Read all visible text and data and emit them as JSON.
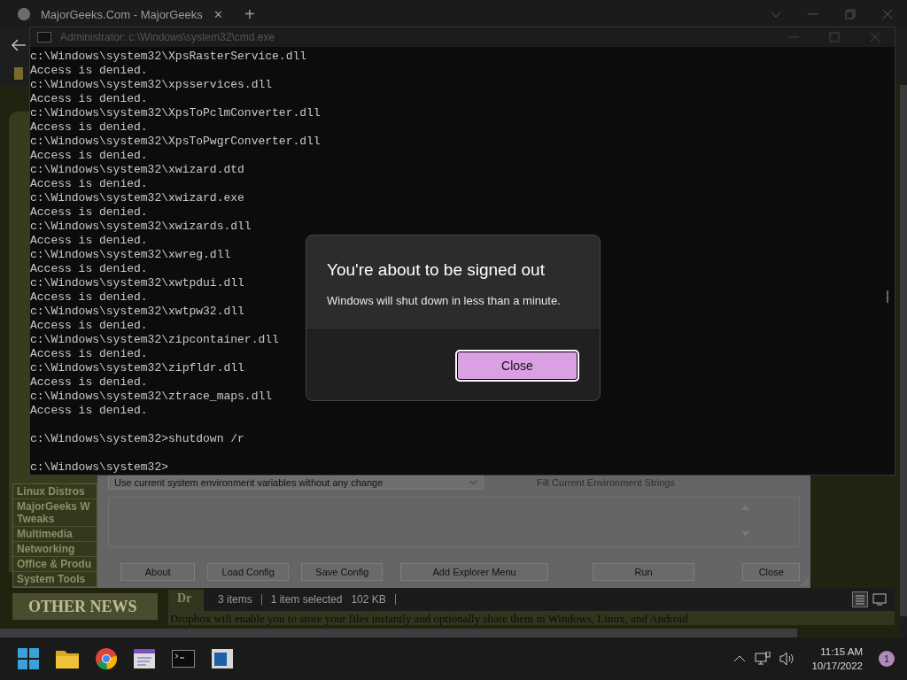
{
  "browser": {
    "tab_title": "MajorGeeks.Com - MajorGeeks",
    "tab_close": "✕",
    "new_tab": "+"
  },
  "website": {
    "sidebar_items": [
      {
        "lines": [
          "Linux Distros"
        ]
      },
      {
        "lines": [
          "MajorGeeks W",
          "Tweaks"
        ]
      },
      {
        "lines": [
          "Multimedia"
        ]
      },
      {
        "lines": [
          "Networking"
        ]
      },
      {
        "lines": [
          "Office & Produ"
        ]
      },
      {
        "lines": [
          "System Tools"
        ]
      }
    ],
    "news_heading": "OTHER NEWS",
    "article_heading": "Dr",
    "article_text": "Dropbox will enable you to store your files instantly and optionally share them in Windows, Linux, and Android"
  },
  "cmd": {
    "title": "Administrator: c:\\Windows\\system32\\cmd.exe",
    "lines": [
      {
        "text": "c:\\Windows\\system32\\XpsRasterService.dll"
      },
      {
        "text": "Access is denied."
      },
      {
        "text": "c:\\Windows\\system32\\xpsservices.dll"
      },
      {
        "text": "Access is denied."
      },
      {
        "text": "c:\\Windows\\system32\\XpsToPclmConverter.dll"
      },
      {
        "text": "Access is denied."
      },
      {
        "text": "c:\\Windows\\system32\\XpsToPwgrConverter.dll"
      },
      {
        "text": "Access is denied."
      },
      {
        "text": "c:\\Windows\\system32\\xwizard.dtd"
      },
      {
        "text": "Access is denied."
      },
      {
        "text": "c:\\Windows\\system32\\xwizard.exe"
      },
      {
        "text": "Access is denied."
      },
      {
        "text": "c:\\Windows\\system32\\xwizards.dll"
      },
      {
        "text": "Access is denied."
      },
      {
        "text": "c:\\Windows\\system32\\xwreg.dll"
      },
      {
        "text": "Access is denied."
      },
      {
        "text": "c:\\Windows\\system32\\xwtpdui.dll"
      },
      {
        "text": "Access is denied."
      },
      {
        "text": "c:\\Windows\\system32\\xwtpw32.dll"
      },
      {
        "text": "Access is denied."
      },
      {
        "text": "c:\\Windows\\system32\\zipcontainer.dll"
      },
      {
        "text": "Access is denied."
      },
      {
        "text": "c:\\Windows\\system32\\zipfldr.dll"
      },
      {
        "text": "Access is denied."
      },
      {
        "text": "c:\\Windows\\system32\\ztrace_maps.dll"
      },
      {
        "text": "Access is denied."
      },
      {
        "kind": "blank"
      },
      {
        "text": "c:\\Windows\\system32>shutdown /r"
      },
      {
        "kind": "blank"
      },
      {
        "text": "c:\\Windows\\system32>"
      }
    ]
  },
  "app": {
    "dropdown_value": "Use current system environment variables without any change",
    "fill_option": {
      "label": "Fill Current Environment Strings",
      "disabled": true
    },
    "buttons": [
      "About",
      "Load Config",
      "Save Config",
      "Add Explorer Menu",
      "Run",
      "Close"
    ]
  },
  "explorer_status": {
    "item_count": "3 items",
    "selection": "1 item selected",
    "size": "102 KB"
  },
  "dialog": {
    "title": "You're about to be signed out",
    "message": "Windows will shut down in less than a minute.",
    "button": "Close"
  },
  "taskbar": {
    "time": "11:15 AM",
    "date": "10/17/2022",
    "notification_count": "1"
  }
}
